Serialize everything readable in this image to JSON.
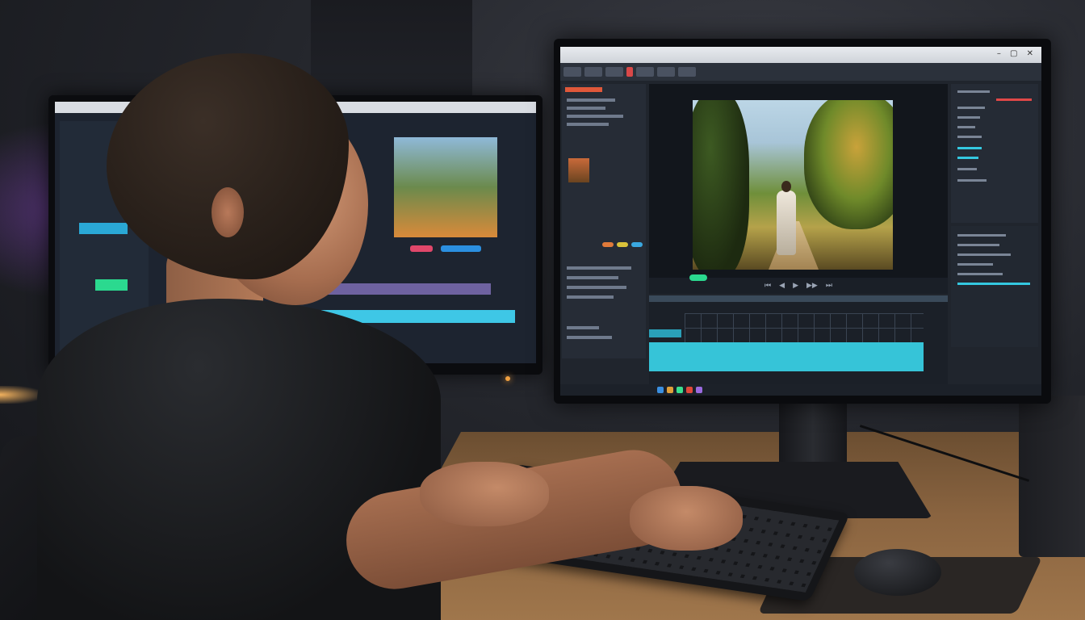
{
  "scene": {
    "subject": "video-editor-at-workstation",
    "colors": {
      "accent_cyan": "#36c4d8",
      "accent_green": "#2bd98f",
      "accent_red": "#e04848",
      "accent_purple": "#8c46c8"
    }
  },
  "software": {
    "window_controls": "– ▢ ✕",
    "viewer_controls": [
      "⏮",
      "◀",
      "▶",
      "▶▶",
      "⏭"
    ]
  }
}
